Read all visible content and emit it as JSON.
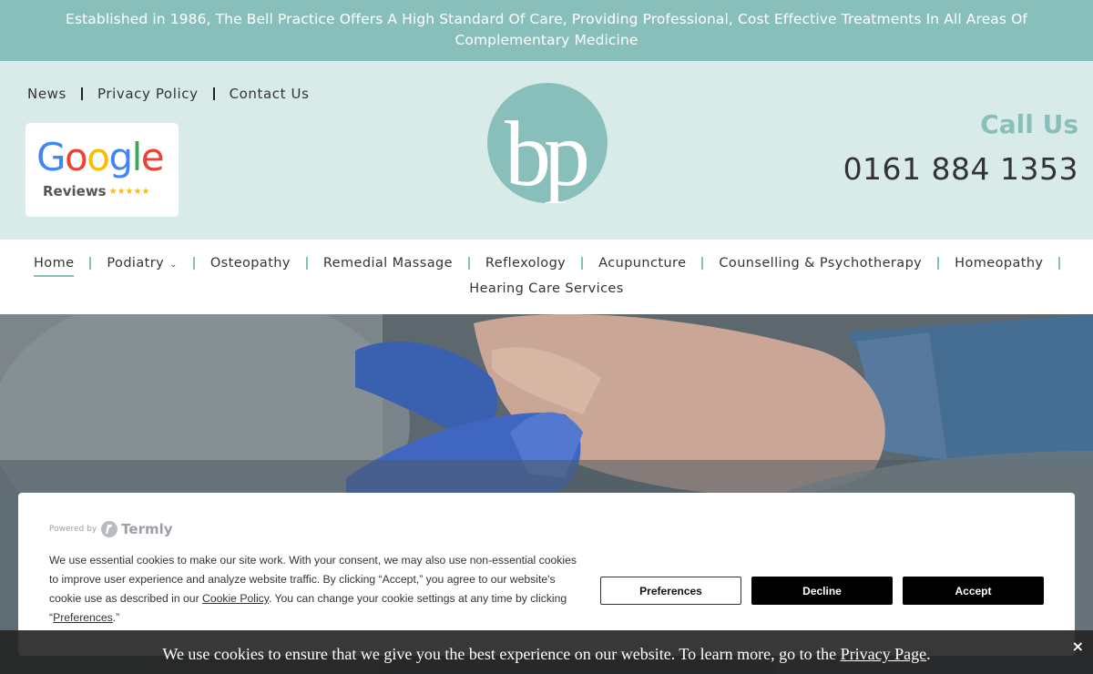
{
  "banner": {
    "text": "Established in 1986, The Bell Practice Offers A High Standard Of Care, Providing Professional, Cost Effective Treatments In All Areas Of Complementary Medicine"
  },
  "header": {
    "top_links": [
      "News",
      "Privacy Policy",
      "Contact Us"
    ],
    "google_badge": {
      "word": [
        "G",
        "o",
        "o",
        "g",
        "l",
        "e"
      ],
      "reviews_label": "Reviews",
      "stars": "★★★★★"
    },
    "logo_text": "bp",
    "call_label": "Call Us",
    "phone": "0161 884 1353"
  },
  "nav": {
    "items": [
      {
        "label": "Home",
        "active": true
      },
      {
        "label": "Podiatry",
        "dropdown": true
      },
      {
        "label": "Osteopathy"
      },
      {
        "label": "Remedial Massage"
      },
      {
        "label": "Reflexology"
      },
      {
        "label": "Acupuncture"
      },
      {
        "label": "Counselling & Psychotherapy"
      },
      {
        "label": "Homeopathy"
      }
    ],
    "second_row": "Hearing Care Services"
  },
  "cookie_dialog": {
    "powered_by": "Powered by",
    "brand": "Termly",
    "text_1": "We use essential cookies to make our site work. With your consent, we may also use non-essential cookies to improve user experience and analyze website traffic. By clicking “Accept,” you agree to our website's cookie use as described in our ",
    "policy_link": "Cookie Policy",
    "text_2": ". You can change your cookie settings at any time by clicking “",
    "preferences_link": "Preferences",
    "text_3": ".”",
    "buttons": {
      "preferences": "Preferences",
      "decline": "Decline",
      "accept": "Accept"
    }
  },
  "cookie_bar": {
    "text": "We use cookies to ensure that we give you the best experience on our website. To learn more, go to the ",
    "link": "Privacy Page",
    "end": ".",
    "close": "×"
  },
  "colors": {
    "accent": "#88bfbb",
    "header_bg": "#d9ebe8"
  }
}
